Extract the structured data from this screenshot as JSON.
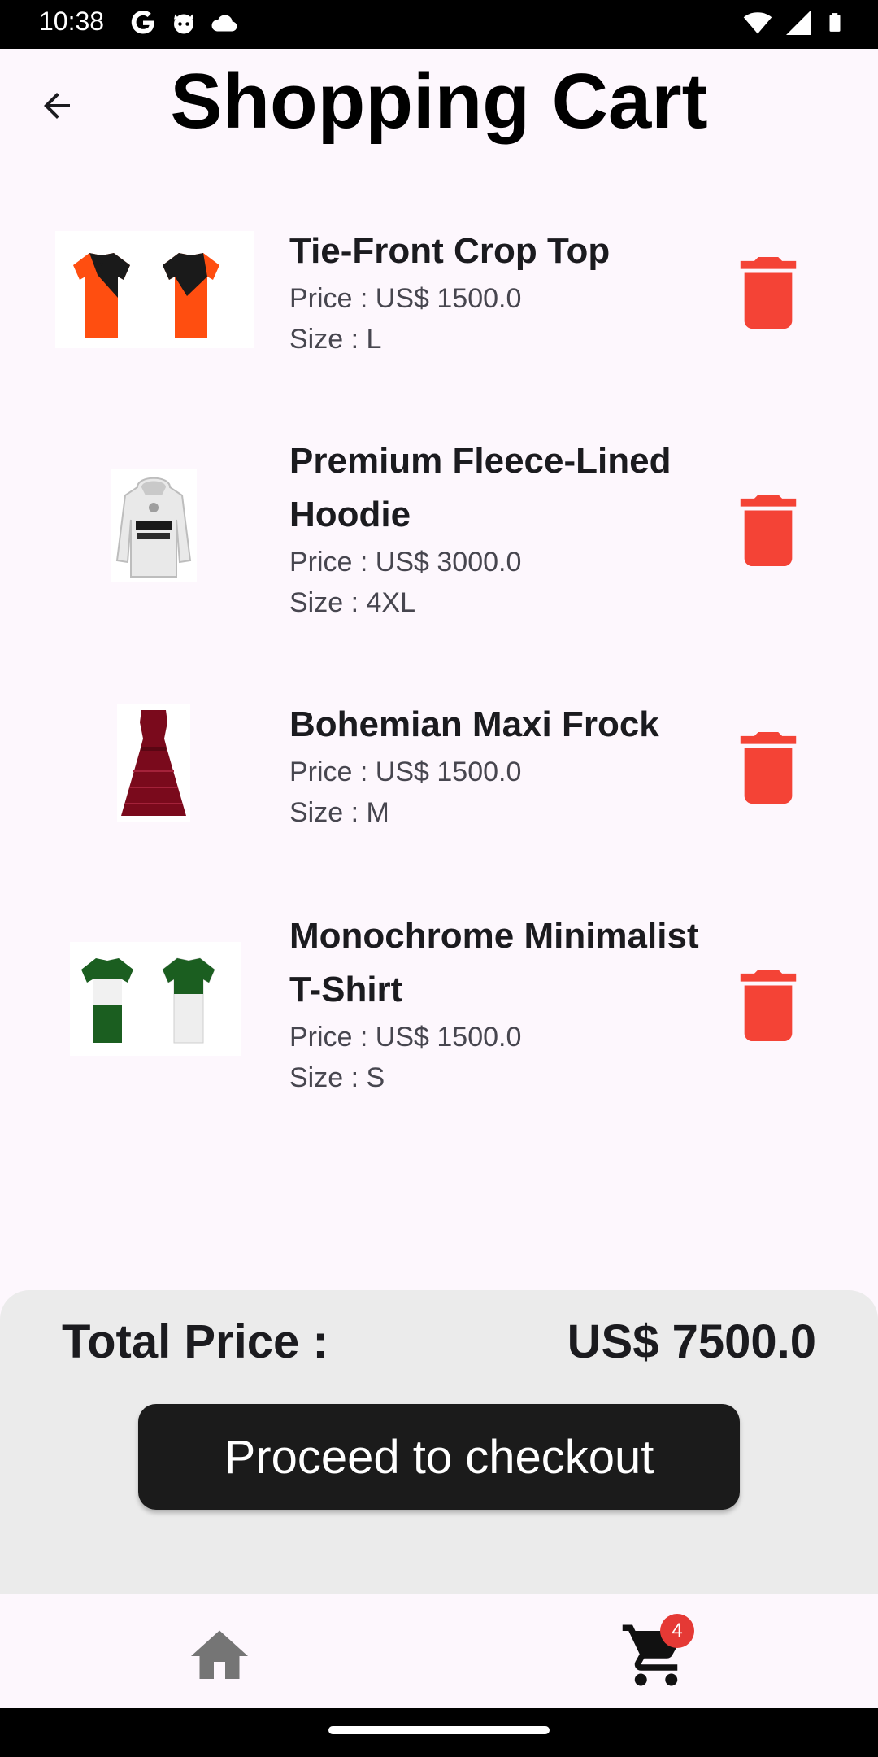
{
  "status_bar": {
    "time": "10:38",
    "left_icons": [
      "google-icon",
      "cat-face-icon",
      "cloud-icon"
    ],
    "right_icons": [
      "wifi-icon",
      "signal-icon",
      "battery-icon"
    ]
  },
  "header": {
    "back_icon": "arrow-back-icon",
    "title": "Shopping Cart"
  },
  "items": [
    {
      "name": "Tie-Front Crop Top",
      "price": "Price : US$ 1500.0",
      "size": "Size : L",
      "image": "orange-black-polo-shirts",
      "delete_icon": "trash-icon"
    },
    {
      "name": "Premium Fleece-Lined Hoodie",
      "price": "Price : US$ 3000.0",
      "size": "Size : 4XL",
      "image": "white-petronas-hoodie",
      "delete_icon": "trash-icon"
    },
    {
      "name": "Bohemian Maxi Frock",
      "price": "Price : US$ 1500.0",
      "size": "Size : M",
      "image": "maroon-lace-dress",
      "delete_icon": "trash-icon"
    },
    {
      "name": "Monochrome Minimalist T-Shirt",
      "price": "Price : US$ 1500.0",
      "size": "Size : S",
      "image": "green-white-polo-shirts",
      "delete_icon": "trash-icon"
    }
  ],
  "summary": {
    "total_label": "Total Price :",
    "total_value": "US$ 7500.0",
    "checkout_label": "Proceed to checkout"
  },
  "bottom_nav": {
    "home_icon": "home-icon",
    "cart_icon": "cart-icon",
    "cart_badge": "4"
  },
  "colors": {
    "background": "#fdf7fd",
    "delete": "#f44336",
    "checkout_bg": "#1b1b1b",
    "panel_bg": "#ebebeb",
    "badge": "#e53935",
    "home_icon": "#757575"
  }
}
